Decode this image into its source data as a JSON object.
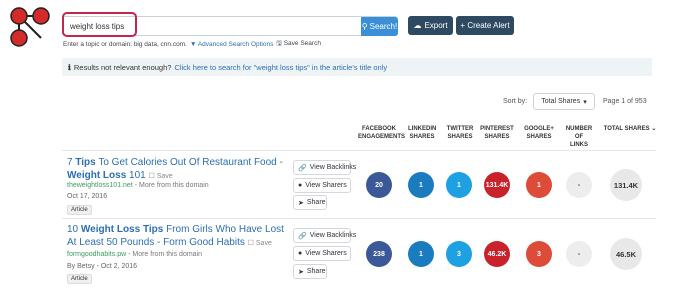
{
  "search": {
    "value": "weight loss tips",
    "button_label": "Search!"
  },
  "actions": {
    "export_label": "Export",
    "create_alert_label": "+ Create Alert"
  },
  "hints": {
    "prompt": "Enter a topic or domain: big data, cnn.com.",
    "advanced_link": "Advanced Search Options",
    "save_search": "Save Search"
  },
  "notice": {
    "text": "Results not relevant enough?",
    "link": "Click here to search for \"weight loss tips\" in the article's title only"
  },
  "sort": {
    "label": "Sort by:",
    "selected": "Total Shares",
    "page_info": "Page 1 of 953"
  },
  "columns": {
    "facebook": [
      "FACEBOOK",
      "ENGAGEMENTS"
    ],
    "linkedin": [
      "LINKEDIN",
      "SHARES"
    ],
    "twitter": [
      "TWITTER",
      "SHARES"
    ],
    "pinterest": [
      "PINTEREST",
      "SHARES"
    ],
    "googleplus": [
      "GOOGLE+",
      "SHARES"
    ],
    "links": [
      "NUMBER OF",
      "LINKS"
    ],
    "total": "TOTAL SHARES"
  },
  "side_buttons": {
    "backlinks": "View Backlinks",
    "sharers": "View Sharers",
    "share": "Share"
  },
  "results": [
    {
      "title_pre": "7 ",
      "title_b1": "Tips",
      "title_mid": " To Get Calories Out Of Restaurant Food - ",
      "title_b2": "Weight Loss",
      "title_post": " 101",
      "save": "Save",
      "domain": "theweightloss101.net",
      "more": " - More from this domain",
      "date": "Oct 17, 2016",
      "tag": "Article",
      "facebook": "20",
      "linkedin": "1",
      "twitter": "1",
      "pinterest": "131.4K",
      "googleplus": "1",
      "links": "-",
      "total": "131.4K"
    },
    {
      "title_pre": "10 ",
      "title_b1": "Weight Loss Tips",
      "title_mid": " From Girls Who Have Lost At Least 50 Pounds - Form Good Habits",
      "title_b2": "",
      "title_post": "",
      "save": "Save",
      "domain": "formgoodhabits.pw",
      "more": " - More from this domain",
      "date": "By Betsy - Oct 2, 2016",
      "tag": "Article",
      "facebook": "238",
      "linkedin": "1",
      "twitter": "3",
      "pinterest": "46.2K",
      "googleplus": "3",
      "links": "-",
      "total": "46.5K"
    }
  ],
  "colors": {
    "facebook": "#3b5998",
    "linkedin": "#1a7bbf",
    "twitter": "#1da1e2",
    "pinterest": "#c8232c",
    "googleplus": "#dd4b39",
    "brand": "#c0264e"
  },
  "icons": {
    "logo": "buzzsumo-logo",
    "search": "search-icon",
    "export": "cloud-download-icon",
    "info": "info-icon",
    "backlinks": "link-icon",
    "sharers": "users-icon",
    "share": "share-icon",
    "bookmark": "bookmark-icon",
    "save_search": "save-icon"
  }
}
